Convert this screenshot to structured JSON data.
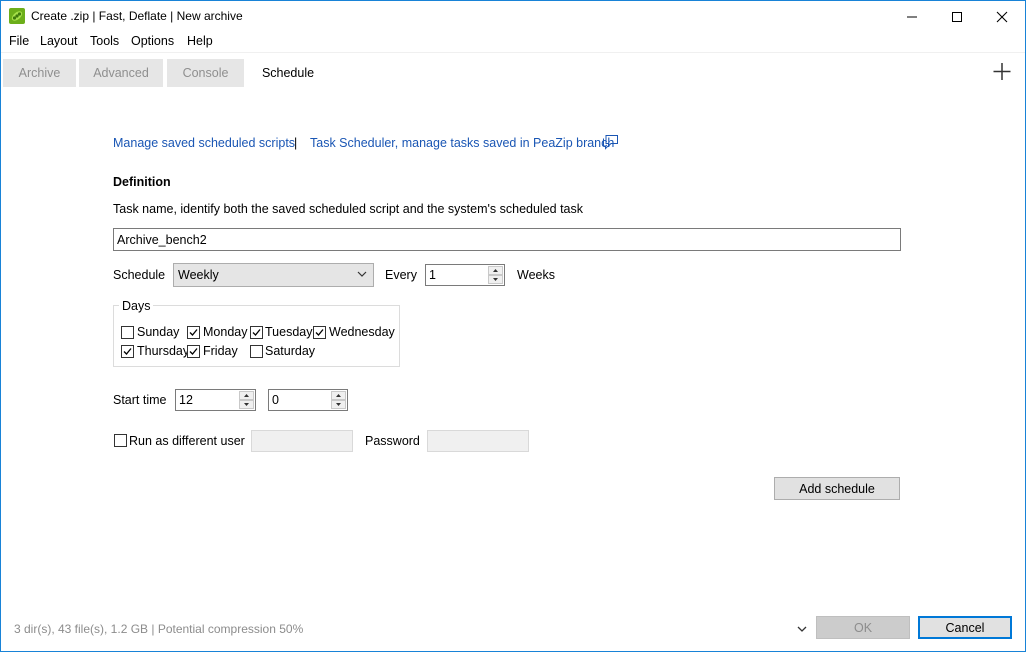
{
  "window": {
    "title": "Create .zip | Fast, Deflate | New archive"
  },
  "menu": [
    "File",
    "Layout",
    "Tools",
    "Options",
    "Help"
  ],
  "tabs": [
    {
      "label": "Archive",
      "active": false
    },
    {
      "label": "Advanced",
      "active": false
    },
    {
      "label": "Console",
      "active": false
    },
    {
      "label": "Schedule",
      "active": true
    }
  ],
  "links": {
    "manage_scripts": "Manage saved scheduled scripts",
    "separator": "|",
    "task_scheduler": "Task Scheduler, manage tasks saved in PeaZip branch"
  },
  "definition": {
    "heading": "Definition",
    "description": "Task name, identify both the saved scheduled script and the system's scheduled task",
    "task_name": "Archive_bench2"
  },
  "schedule": {
    "label": "Schedule",
    "selected": "Weekly",
    "every_label": "Every",
    "every_value": "1",
    "unit_label": "Weeks"
  },
  "days": {
    "group_label": "Days",
    "items": [
      {
        "label": "Sunday",
        "checked": false
      },
      {
        "label": "Monday",
        "checked": true
      },
      {
        "label": "Tuesday",
        "checked": true
      },
      {
        "label": "Wednesday",
        "checked": true
      },
      {
        "label": "Thursday",
        "checked": true
      },
      {
        "label": "Friday",
        "checked": true
      },
      {
        "label": "Saturday",
        "checked": false
      }
    ]
  },
  "start_time": {
    "label": "Start time",
    "hour": "12",
    "minute": "0"
  },
  "run_as": {
    "label": "Run as different user",
    "checked": false,
    "password_label": "Password"
  },
  "buttons": {
    "add_schedule": "Add schedule",
    "ok": "OK",
    "cancel": "Cancel"
  },
  "status": {
    "text": "3 dir(s), 43 file(s), 1.2 GB | Potential compression 50%"
  },
  "colors": {
    "link": "#1a56b4",
    "accent": "#0078d7",
    "app_icon": "#7cc21b"
  }
}
